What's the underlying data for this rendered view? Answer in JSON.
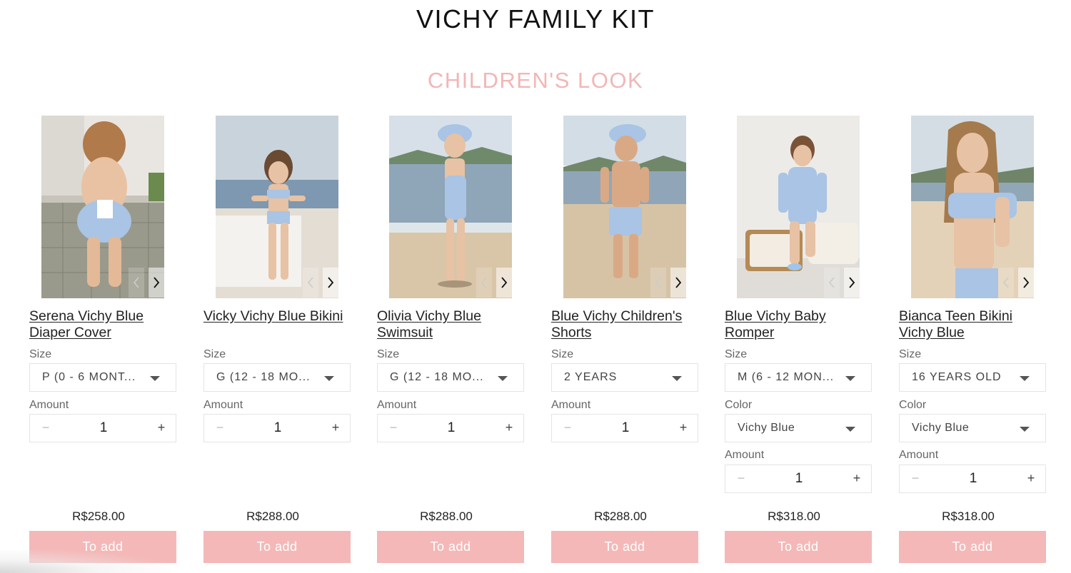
{
  "page": {
    "title": "VICHY FAMILY KIT",
    "section_title": "CHILDREN'S LOOK"
  },
  "colors": {
    "accent_pink": "#f4b8b8",
    "section_pink": "#f2b6b6",
    "text_dark": "#222222"
  },
  "icons": {
    "prev": "chevron-left-icon",
    "next": "chevron-right-icon",
    "dropdown": "caret-down-icon",
    "decrement": "minus-icon",
    "increment": "plus-icon"
  },
  "products": [
    {
      "name": "Serena Vichy Blue Diaper Cover",
      "size_label": "Size",
      "size_value": "P (0 - 6 MONT...",
      "amount_label": "Amount",
      "quantity": "1",
      "minus": "−",
      "plus": "+",
      "price": "R$258.00",
      "button": "To add"
    },
    {
      "name": "Vicky Vichy Blue Bikini",
      "size_label": "Size",
      "size_value": "G (12 - 18 MO...",
      "amount_label": "Amount",
      "quantity": "1",
      "minus": "−",
      "plus": "+",
      "price": "R$288.00",
      "button": "To add"
    },
    {
      "name": "Olivia Vichy Blue Swimsuit",
      "size_label": "Size",
      "size_value": "G (12 - 18 MO...",
      "amount_label": "Amount",
      "quantity": "1",
      "minus": "−",
      "plus": "+",
      "price": "R$288.00",
      "button": "To add"
    },
    {
      "name": "Blue Vichy Children's Shorts",
      "size_label": "Size",
      "size_value": "2 YEARS",
      "amount_label": "Amount",
      "quantity": "1",
      "minus": "−",
      "plus": "+",
      "price": "R$288.00",
      "button": "To add"
    },
    {
      "name": "Blue Vichy Baby Romper",
      "size_label": "Size",
      "size_value": "M (6 - 12 MON...",
      "color_label": "Color",
      "color_value": "Vichy Blue",
      "amount_label": "Amount",
      "quantity": "1",
      "minus": "−",
      "plus": "+",
      "price": "R$318.00",
      "button": "To add"
    },
    {
      "name": "Bianca Teen Bikini Vichy Blue",
      "size_label": "Size",
      "size_value": "16 YEARS OLD",
      "color_label": "Color",
      "color_value": "Vichy Blue",
      "amount_label": "Amount",
      "quantity": "1",
      "minus": "−",
      "plus": "+",
      "price": "R$318.00",
      "button": "To add"
    }
  ]
}
